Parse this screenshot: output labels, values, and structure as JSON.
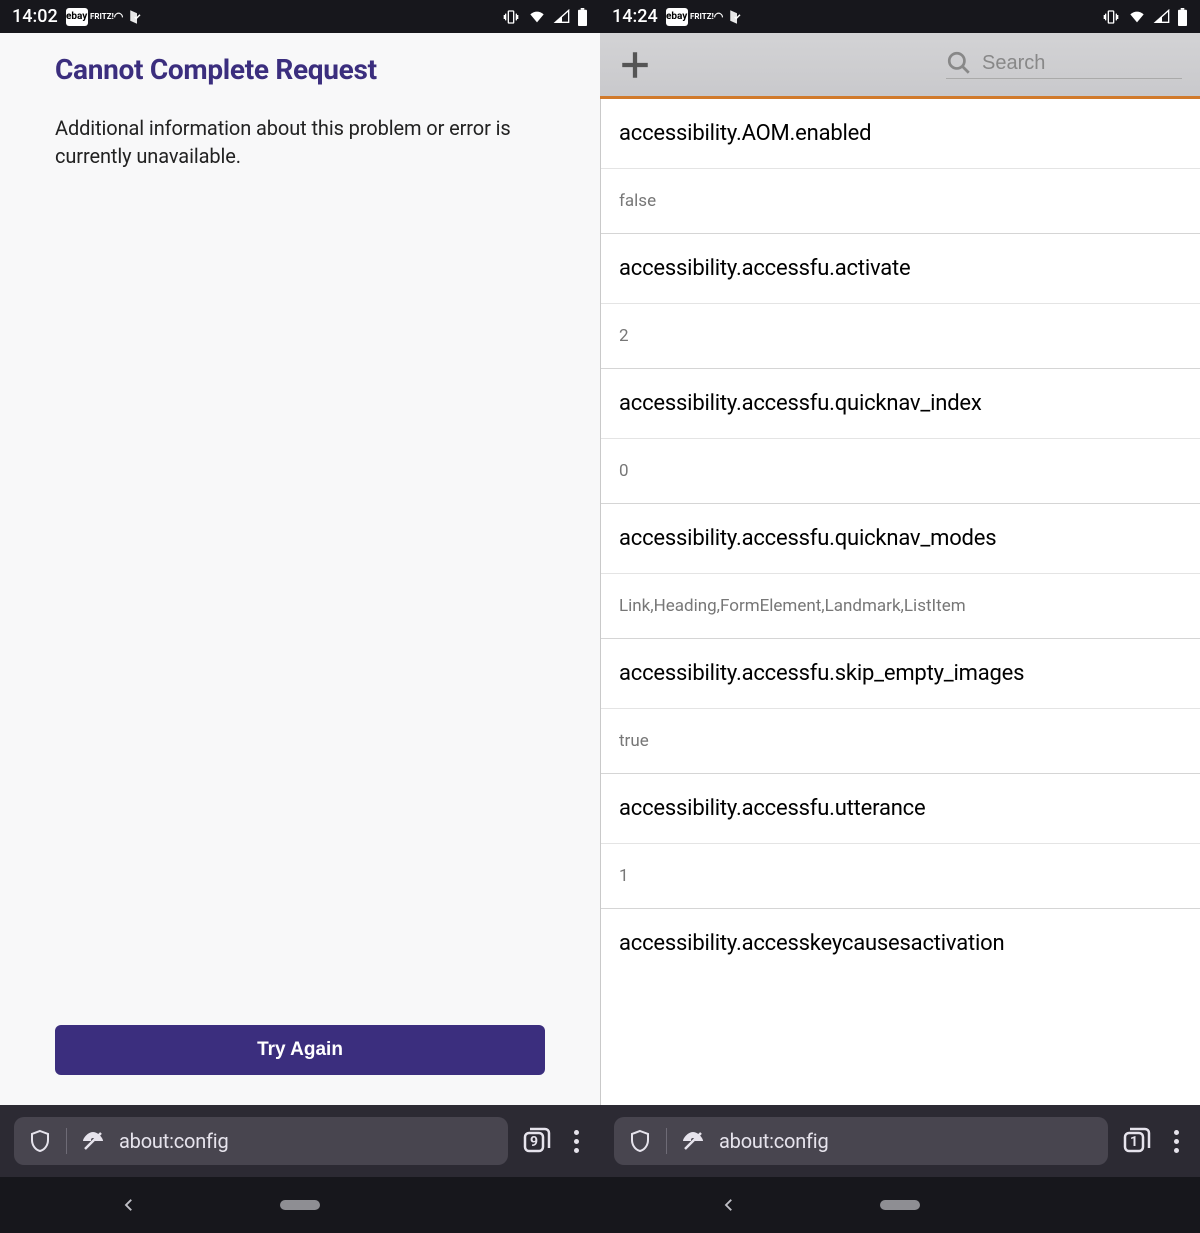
{
  "left": {
    "status": {
      "time": "14:02",
      "ebay": "ebay",
      "fritz": "FRITZ!"
    },
    "error_title": "Cannot Complete Request",
    "error_msg": "Additional information about this problem or error is currently unavailable.",
    "try_again": "Try Again",
    "url": "about:config",
    "tab_count": "9"
  },
  "right": {
    "status": {
      "time": "14:24",
      "ebay": "ebay",
      "fritz": "FRITZ!"
    },
    "search_placeholder": "Search",
    "prefs": [
      {
        "name": "accessibility.AOM.enabled",
        "value": "false"
      },
      {
        "name": "accessibility.accessfu.activate",
        "value": "2"
      },
      {
        "name": "accessibility.accessfu.quicknav_index",
        "value": "0"
      },
      {
        "name": "accessibility.accessfu.quicknav_modes",
        "value": "Link,Heading,FormElement,Landmark,ListItem"
      },
      {
        "name": "accessibility.accessfu.skip_empty_images",
        "value": "true"
      },
      {
        "name": "accessibility.accessfu.utterance",
        "value": "1"
      },
      {
        "name": "accessibility.accesskeycausesactivation",
        "value": ""
      }
    ],
    "url": "about:config",
    "tab_count": "1"
  }
}
